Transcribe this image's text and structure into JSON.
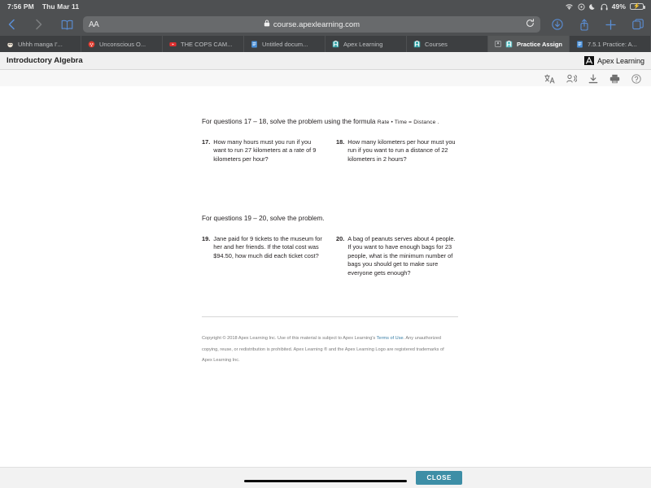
{
  "status_bar": {
    "time": "7:56 PM",
    "date": "Thu Mar 11",
    "battery_percent": "49%",
    "icons": [
      "wifi-icon",
      "rotation-lock-icon",
      "do-not-disturb-moon-icon",
      "headphones-icon",
      "battery-charging-icon"
    ]
  },
  "browser": {
    "url": "course.apexlearning.com",
    "aa_label": "AA",
    "lock_icon": "lock-icon",
    "reload_icon": "reload-icon",
    "back_icon": "back-chevron-icon",
    "forward_icon": "forward-chevron-icon",
    "bookmarks_icon": "book-icon",
    "downloads_icon": "download-circle-icon",
    "share_icon": "share-icon",
    "new_tab_icon": "plus-icon",
    "tabs_icon": "tabs-overview-icon",
    "tabs": [
      {
        "label": "Uhhh manga I'...",
        "favicon": "manga-favicon",
        "active": false,
        "closable": false
      },
      {
        "label": "Unconscious O...",
        "favicon": "skull-favicon",
        "active": false,
        "closable": false
      },
      {
        "label": "THE COPS CAM...",
        "favicon": "youtube-favicon",
        "active": false,
        "closable": false
      },
      {
        "label": "Untitled docum...",
        "favicon": "google-docs-favicon",
        "active": false,
        "closable": false
      },
      {
        "label": "Apex Learning",
        "favicon": "apex-favicon",
        "active": false,
        "closable": false
      },
      {
        "label": "Courses",
        "favicon": "apex-favicon",
        "active": false,
        "closable": false
      },
      {
        "label": "Practice Assign...",
        "favicon": "apex-favicon",
        "active": true,
        "closable": true
      },
      {
        "label": "7.5.1 Practice: A...",
        "favicon": "google-docs-favicon",
        "active": false,
        "closable": false
      }
    ],
    "close_tab_glyph": "×"
  },
  "page_header": {
    "course_title": "Introductory Algebra",
    "brand_text": "Apex Learning",
    "brand_mark_icon": "apex-logo-icon",
    "tools": [
      {
        "name": "translate-icon",
        "glyph": "文"
      },
      {
        "name": "read-aloud-icon",
        "glyph": ""
      },
      {
        "name": "download-icon",
        "glyph": ""
      },
      {
        "name": "print-icon",
        "glyph": ""
      },
      {
        "name": "help-icon",
        "glyph": "?"
      }
    ]
  },
  "worksheet": {
    "instruction_1": "For questions 17 – 18, solve the problem using the formula",
    "formula_1": "Rate • Time = Distance .",
    "instruction_2": "For questions 19 – 20, solve the problem.",
    "questions": [
      {
        "number": "17.",
        "text": "How many hours must you run if you want to run 27 kilometers at a rate of 9 kilometers per hour?"
      },
      {
        "number": "18.",
        "text": "How many kilometers per hour must you run if you want to run a distance of 22 kilometers in 2 hours?"
      },
      {
        "number": "19.",
        "text": "Jane paid for 9 tickets to the museum for her and her friends. If the total cost was $94.50, how much did each ticket cost?"
      },
      {
        "number": "20.",
        "text": "A bag of peanuts serves about 4 people. If you want to have enough bags for 23 people, what is the minimum number of bags you should get to make sure everyone gets enough?"
      }
    ],
    "footer": {
      "part1": "Copyright © 2018 Apex Learning Inc. Use of this material is subject to Apex Learning's ",
      "link": "Terms of Use",
      "part2": ". Any unauthorized copying, reuse, or redistribution is prohibited. Apex Learning ® and the Apex Learning Logo are registered trademarks of Apex Learning Inc."
    }
  },
  "bottom_bar": {
    "close_label": "CLOSE"
  }
}
